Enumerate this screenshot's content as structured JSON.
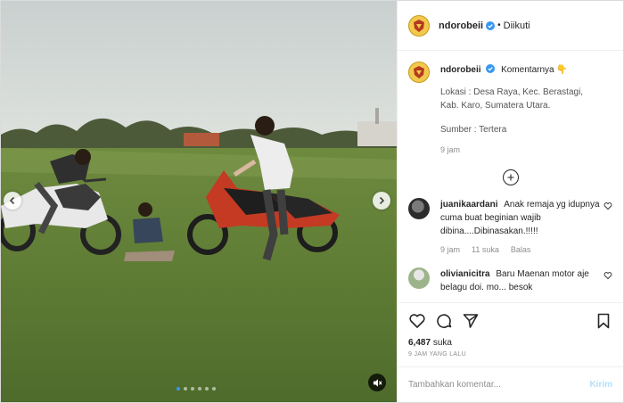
{
  "header": {
    "username": "ndorobeii",
    "follow_status": "Diikuti",
    "separator": "•"
  },
  "caption": {
    "username": "ndorobeii",
    "title": "Komentarnya 👇",
    "lines": [
      "Lokasi : Desa Raya, Kec. Berastagi,",
      "Kab. Karo, Sumatera Utara.",
      "",
      "Sumber : Tertera"
    ],
    "time": "9 jam"
  },
  "comments": [
    {
      "username": "juanikaardani",
      "text": "Anak remaja yg idupnya cuma buat beginian wajib dibina....Dibinasakan.!!!!!",
      "time": "9 jam",
      "likes": "11 suka",
      "reply": "Balas"
    },
    {
      "username": "olivianicitra",
      "text": "Baru Maenan motor aje belagu doi. mo... besok",
      "time": "",
      "likes": "",
      "reply": ""
    }
  ],
  "actions": {
    "likes_count": "6,487",
    "likes_unit": "suka",
    "posted": "9 JAM YANG LALU"
  },
  "add_comment": {
    "placeholder": "Tambahkan komentar...",
    "post_label": "Kirim"
  },
  "carousel": {
    "dot_count": 6,
    "active_index": 0
  },
  "colors": {
    "accent": "#3897f0",
    "post_disabled": "#b2dffc",
    "muted_text": "#8e8e8e"
  },
  "icons": {
    "like": "heart-icon",
    "comment": "comment-icon",
    "share": "paper-plane-icon",
    "save": "bookmark-icon",
    "mute": "speaker-muted-icon",
    "more": "plus-circle-icon"
  }
}
